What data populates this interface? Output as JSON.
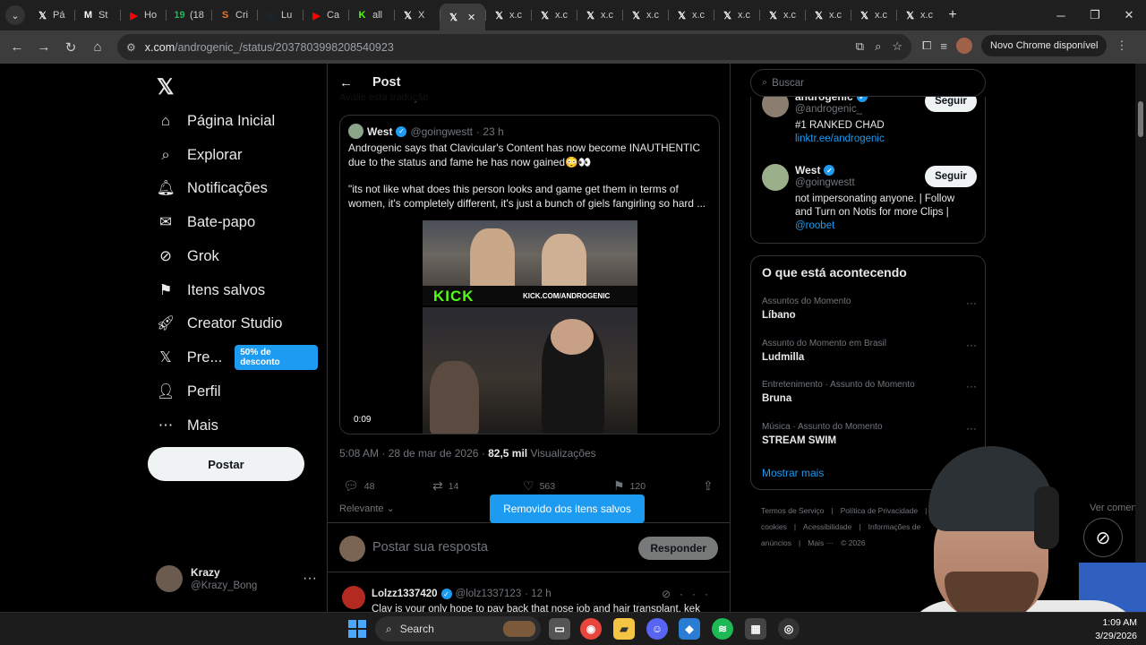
{
  "browser": {
    "tabs": [
      {
        "icon": "x-icon",
        "label": "Pá",
        "color": "#ffffff",
        "glyph": "𝕏"
      },
      {
        "icon": "mail-icon",
        "label": "St",
        "color": "#ffffff",
        "glyph": "M"
      },
      {
        "icon": "youtube-icon",
        "label": "Ho",
        "color": "#ff0000",
        "glyph": "▶"
      },
      {
        "icon": "counter-icon",
        "label": "(18",
        "color": "#1db954",
        "glyph": "19"
      },
      {
        "icon": "crunchyroll-icon",
        "label": "Cri",
        "color": "#f47521",
        "glyph": "S"
      },
      {
        "icon": "steam-icon",
        "label": "Lu",
        "color": "#1b2838",
        "glyph": "◎"
      },
      {
        "icon": "youtube-icon",
        "label": "Ca",
        "color": "#ff0000",
        "glyph": "▶"
      },
      {
        "icon": "kick-icon",
        "label": "all",
        "color": "#53fc18",
        "glyph": "K"
      },
      {
        "icon": "x-icon",
        "label": "X",
        "color": "#ffffff",
        "glyph": "𝕏"
      },
      {
        "icon": "x-icon",
        "label": "",
        "color": "#ffffff",
        "glyph": "𝕏",
        "active": true
      },
      {
        "icon": "x-icon",
        "label": "x.c",
        "color": "#ffffff",
        "glyph": "𝕏"
      },
      {
        "icon": "x-icon",
        "label": "x.c",
        "color": "#ffffff",
        "glyph": "𝕏"
      },
      {
        "icon": "x-icon",
        "label": "x.c",
        "color": "#ffffff",
        "glyph": "𝕏"
      },
      {
        "icon": "x-icon",
        "label": "x.c",
        "color": "#ffffff",
        "glyph": "𝕏"
      },
      {
        "icon": "x-icon",
        "label": "x.c",
        "color": "#ffffff",
        "glyph": "𝕏"
      },
      {
        "icon": "x-icon",
        "label": "x.c",
        "color": "#ffffff",
        "glyph": "𝕏"
      },
      {
        "icon": "x-icon",
        "label": "x.c",
        "color": "#ffffff",
        "glyph": "𝕏"
      },
      {
        "icon": "x-icon",
        "label": "x.c",
        "color": "#ffffff",
        "glyph": "𝕏"
      },
      {
        "icon": "x-icon",
        "label": "x.c",
        "color": "#ffffff",
        "glyph": "𝕏"
      },
      {
        "icon": "x-icon",
        "label": "x.c",
        "color": "#ffffff",
        "glyph": "𝕏"
      }
    ],
    "url_host": "x.com",
    "url_path": "/androgenic_/status/2037803998208540923",
    "update_label": "Novo Chrome disponível"
  },
  "sidebar": {
    "items": [
      {
        "label": "Página Inicial",
        "icon": "home-icon",
        "glyph": "⌂"
      },
      {
        "label": "Explorar",
        "icon": "search-icon",
        "glyph": "⌕"
      },
      {
        "label": "Notificações",
        "icon": "bell-icon",
        "glyph": "🔔︎"
      },
      {
        "label": "Bate-papo",
        "icon": "mail-icon",
        "glyph": "✉"
      },
      {
        "label": "Grok",
        "icon": "grok-icon",
        "glyph": "⊘"
      },
      {
        "label": "Itens salvos",
        "icon": "bookmark-icon",
        "glyph": "⚑"
      },
      {
        "label": "Creator Studio",
        "icon": "rocket-icon",
        "glyph": "🚀︎"
      },
      {
        "label": "Pre...",
        "icon": "x-premium-icon",
        "glyph": "𝕏"
      },
      {
        "label": "Perfil",
        "icon": "person-icon",
        "glyph": "👤︎"
      },
      {
        "label": "Mais",
        "icon": "more-circle-icon",
        "glyph": "⋯"
      }
    ],
    "premium_badge": "50% de desconto",
    "post_button": "Postar",
    "account_name": "Krazy",
    "account_handle": "@Krazy_Bong"
  },
  "main": {
    "header_title": "Post",
    "translate_text": "Avalie esta tradução",
    "quote": {
      "name": "West",
      "handle": "@goingwestt",
      "time": "· 23 h",
      "text_1": "Androgenic says that Clavicular's Content has now become INAUTHENTIC due to the status and fame he has now gained😳👀",
      "text_2": "\"its not like what does this person looks and game get them in terms of women, it's completely different, it's just a bunch of giels fangirling so hard ...",
      "video_time": "0:09",
      "kick_logo": "KICK",
      "kick_url": "KICK.COM/ANDROGENIC"
    },
    "timestamp": "5:08 AM · 28 de mar de 2026 · ",
    "views": "82,5 mil",
    "views_label": " Visualizações",
    "actions": {
      "replies": "48",
      "reposts": "14",
      "likes": "563",
      "bookmarks": "120"
    },
    "sort_label": "Relevante ⌄",
    "comments_link": "Ver comentários ›",
    "reply_placeholder": "Postar sua resposta",
    "reply_button": "Responder",
    "reply": {
      "name": "Lolzz1337420",
      "handle": "@lolz1337123",
      "time": "· 12 h",
      "text": "Clav is your only hope to pay back that nose job and hair transplant, kek"
    },
    "toast": "Removido dos itens salvos"
  },
  "right": {
    "search_placeholder": "Buscar",
    "who": [
      {
        "name": "androgenic",
        "handle": "@androgenic_",
        "bio": "#1 RANKED CHAD",
        "link": "linktr.ee/androgenic",
        "button": "Seguir"
      },
      {
        "name": "West",
        "handle": "@goingwestt",
        "bio": "not impersonating anyone. | Follow and Turn on Notis for more Clips | ",
        "link": "@roobet",
        "button": "Seguir"
      }
    ],
    "trends_title": "O que está acontecendo",
    "trends": [
      {
        "context": "Assuntos do Momento",
        "topic": "Líbano"
      },
      {
        "context": "Assunto do Momento em Brasil",
        "topic": "Ludmilla"
      },
      {
        "context": "Entretenimento · Assunto do Momento",
        "topic": "Bruna"
      },
      {
        "context": "Música · Assunto do Momento",
        "topic": "STREAM SWIM"
      }
    ],
    "show_more": "Mostrar mais",
    "footer": [
      "Termos de Serviço",
      "|",
      "Política de Privacidade",
      "|",
      "Política de cookies",
      "|",
      "Acessibilidade",
      "|",
      "Informações de anúncios",
      "|",
      "Mais ···",
      "© 2026"
    ]
  },
  "taskbar": {
    "search_label": "Search",
    "time": "1:09 AM",
    "date": "3/29/2026"
  },
  "colors": {
    "accent": "#1d9bf0",
    "kick_green": "#53fc18",
    "background": "#000000"
  }
}
